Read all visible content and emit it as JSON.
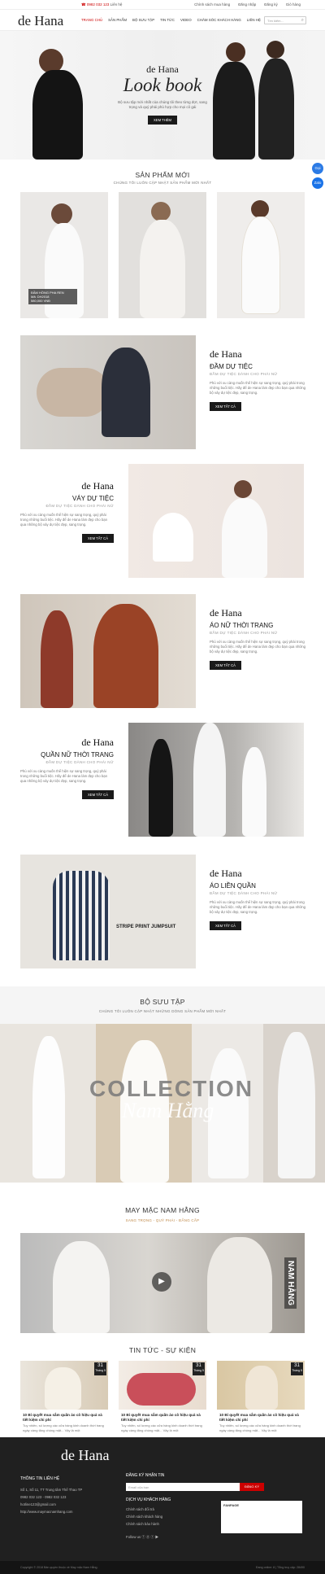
{
  "topbar": {
    "hotline": "0982 032 123",
    "hotline_note": "Liên hệ",
    "account": "Chính sách mua hàng",
    "login": "Đăng nhập",
    "register": "Đăng ký",
    "cart": "Giỏ hàng"
  },
  "header": {
    "logo": "de Hana",
    "menu": [
      "TRANG CHỦ",
      "SẢN PHẨM",
      "BỘ SƯU TẬP",
      "TIN TỨC",
      "VIDEO",
      "CHĂM SÓC KHÁCH HÀNG",
      "LIÊN HỆ"
    ],
    "search_placeholder": "Tìm kiếm..."
  },
  "hero": {
    "brand": "de Hana",
    "title": "Look book",
    "desc": "Bộ sưu tập mới nhất của chúng tôi theo từng đợt, sang trọng và quý phái phù hợp cho mọi cô gái",
    "button": "XEM THÊM"
  },
  "floating": [
    "Gọi",
    "Zalo"
  ],
  "new_products": {
    "title": "SẢN PHẨM MỚI",
    "subtitle": "CHÚNG TÔI LUÔN CẬP NHẬT SẢN PHẨM MỚI NHẤT",
    "tag_name": "ĐẦM HỒNG PHA REN",
    "tag_code": "Mã: DH2018",
    "tag_price": "580,000 VNĐ"
  },
  "features": [
    {
      "logo": "de Hana",
      "title": "ĐẦM DỰ TIỆC",
      "sub": "ĐẦM DỰ TIỆC DÀNH CHO PHÁI NỮ",
      "desc": "Phù với xu càng muốn thể hiện sự sang trọng, quý phái trong những buổi tiệc. Hãy để de Hana làm đẹp cho bạn qua những bộ váy dự tiệc đẹp, sang trọng.",
      "button": "XEM TẤT CẢ"
    },
    {
      "logo": "de Hana",
      "title": "VÁY DỰ TIỆC",
      "sub": "ĐẦM DỰ TIỆC DÀNH CHO PHÁI NỮ",
      "desc": "Phù với xu càng muốn thể hiện sự sang trọng, quý phái trong những buổi tiệc. Hãy để de Hana làm đẹp cho bạn qua những bộ váy dự tiệc đẹp, sang trọng.",
      "button": "XEM TẤT CẢ"
    },
    {
      "logo": "de Hana",
      "title": "ÁO NỮ THỜI TRANG",
      "sub": "ĐẦM DỰ TIỆC DÀNH CHO PHÁI NỮ",
      "desc": "Phù với xu càng muốn thể hiện sự sang trọng, quý phái trong những buổi tiệc. Hãy để de Hana làm đẹp cho bạn qua những bộ váy dự tiệc đẹp, sang trọng.",
      "button": "XEM TẤT CẢ"
    },
    {
      "logo": "de Hana",
      "title": "QUẦN NỮ THỜI TRANG",
      "sub": "ĐẦM DỰ TIỆC DÀNH CHO PHÁI NỮ",
      "desc": "Phù với xu càng muốn thể hiện sự sang trọng, quý phái trong những buổi tiệc. Hãy để de Hana làm đẹp cho bạn qua những bộ váy dự tiệc đẹp, sang trọng.",
      "button": "XEM TẤT CẢ"
    },
    {
      "logo": "de Hana",
      "title": "ÁO LIỀN QUẦN",
      "sub": "ĐẦM DỰ TIỆC DÀNH CHO PHÁI NỮ",
      "desc": "Phù với xu càng muốn thể hiện sự sang trọng, quý phái trong những buổi tiệc. Hãy để de Hana làm đẹp cho bạn qua những bộ váy dự tiệc đẹp, sang trọng.",
      "button": "XEM TẤT CẢ",
      "image_caption": "STRIPE PRINT JUMPSUIT"
    }
  ],
  "collection": {
    "title": "BỘ SƯU TẬP",
    "subtitle": "CHÚNG TÔI LUÔN CẬP NHẬT NHỮNG DÒNG SẢN PHẨM MỚI NHẤT",
    "word": "COLLECTION",
    "script": "Nam Hằng"
  },
  "video": {
    "title": "MAY MẶC NAM HẰNG",
    "subtitle": "SANG TRỌNG - QUÝ PHÁI - ĐẲNG CẤP",
    "side_text": "NAM HẰNG"
  },
  "news": {
    "title": "TIN TỨC - SỰ KIỆN",
    "items": [
      {
        "day": "31",
        "month": "Tháng 5",
        "title": "10 Bí quyết mua sắm quần áo cô hiệu quả và tiết kiệm chi phí",
        "desc": "Tuy nhiên, số lượng các cửa hàng kinh doanh thời trang ngày càng tăng chóng mặt... Vậy là một"
      },
      {
        "day": "31",
        "month": "Tháng 5",
        "title": "10 Bí quyết mua sắm quần áo cô hiệu quả và tiết kiệm chi phí",
        "desc": "Tuy nhiên, số lượng các cửa hàng kinh doanh thời trang ngày càng tăng chóng mặt... Vậy là một"
      },
      {
        "day": "31",
        "month": "Tháng 5",
        "title": "10 Bí quyết mua sắm quần áo cô hiệu quả và tiết kiệm chi phí",
        "desc": "Tuy nhiên, số lượng các cửa hàng kinh doanh thời trang ngày càng tăng chóng mặt... Vậy là một"
      }
    ]
  },
  "footer": {
    "logo": "de Hana",
    "contact_title": "THÔNG TIN LIÊN HỆ",
    "contact": [
      "Số 1, Số 11, TT Trung tâm Thể Thao TP",
      "0982 032 123 - 0982 032 123",
      "hotline123@gmail.com",
      "http://www.maymacnamhang.com"
    ],
    "newsletter_title": "ĐĂNG KÝ NHẬN TIN",
    "newsletter_placeholder": "Email của bạn",
    "newsletter_button": "ĐĂNG KÝ",
    "service_title": "DỊCH VỤ KHÁCH HÀNG",
    "services": [
      "Chính sách đổi trả",
      "Chính sách khách hàng",
      "Chính sách bảo hành"
    ],
    "follow": "Follow us",
    "fanpage": "FANPAGE",
    "copyright": "Copyright © 2018 Bản quyền thuộc về May mặc Nam Hằng.",
    "stats": "Đang online: 8 | Tổng truy cập: 28490"
  },
  "colors": {
    "accent": "#cc0000",
    "dark": "#1a1a1a",
    "footer": "#202020"
  }
}
